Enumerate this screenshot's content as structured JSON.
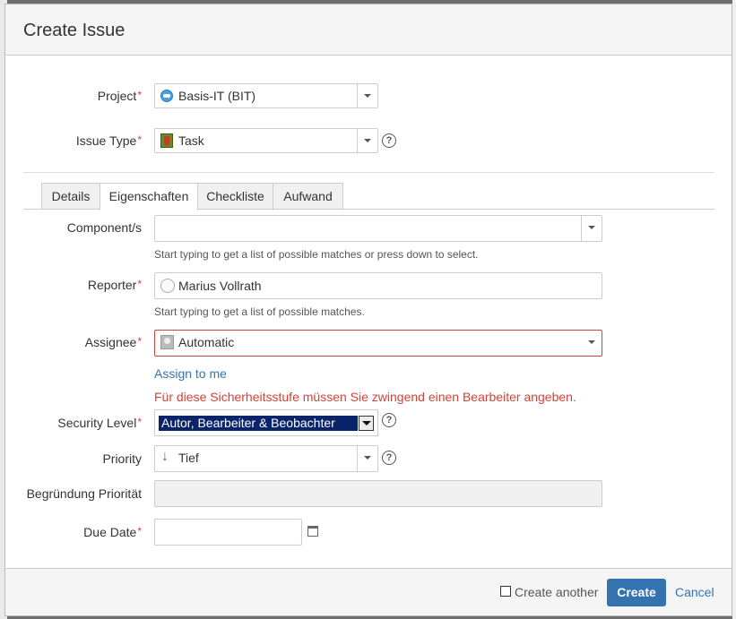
{
  "dialog": {
    "title": "Create Issue"
  },
  "fields": {
    "project": {
      "label": "Project",
      "value": "Basis-IT (BIT)",
      "icon": "project-cloud-icon"
    },
    "issue_type": {
      "label": "Issue Type",
      "value": "Task",
      "icon": "task-icon"
    }
  },
  "tabs": [
    {
      "label": "Details"
    },
    {
      "label": "Eigenschaften"
    },
    {
      "label": "Checkliste"
    },
    {
      "label": "Aufwand"
    }
  ],
  "tab_active": "Eigenschaften",
  "components": {
    "label": "Component/s",
    "value": "",
    "hint": "Start typing to get a list of possible matches or press down to select."
  },
  "reporter": {
    "label": "Reporter",
    "value": "Marius Vollrath",
    "hint": "Start typing to get a list of possible matches."
  },
  "assignee": {
    "label": "Assignee",
    "value": "Automatic",
    "assign_to_me": "Assign to me",
    "error": "Für diese Sicherheitsstufe müssen Sie zwingend einen Bearbeiter angeben."
  },
  "security_level": {
    "label": "Security Level",
    "value": "Autor, Bearbeiter & Beobachter"
  },
  "priority": {
    "label": "Priority",
    "value": "Tief"
  },
  "begruendung": {
    "label": "Begründung Priorität",
    "value": ""
  },
  "due_date": {
    "label": "Due Date",
    "value": ""
  },
  "required_marker": "*",
  "help_glyph": "?",
  "footer": {
    "create_another": "Create another",
    "create": "Create",
    "cancel": "Cancel"
  },
  "colors": {
    "accent": "#3572b0",
    "error": "#d04437",
    "header_bg": "#f5f5f5"
  }
}
